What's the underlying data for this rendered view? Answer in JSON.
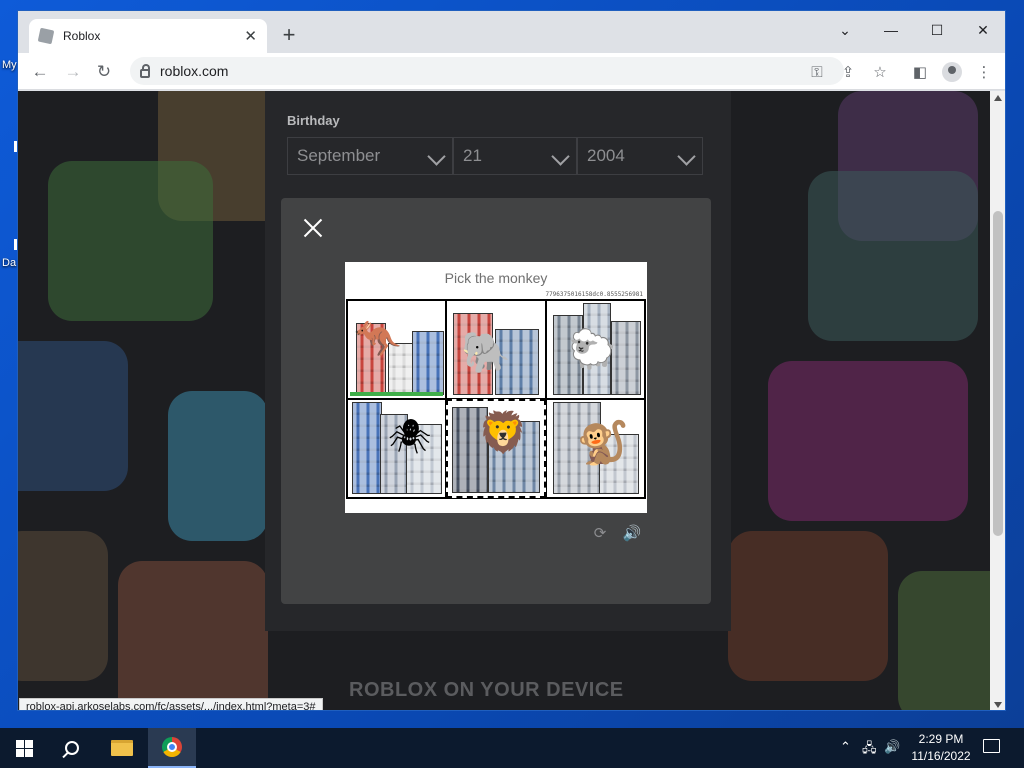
{
  "desktop": {
    "icon_label_1": "My",
    "icon_label_2": "Da"
  },
  "browser": {
    "tab_title": "Roblox",
    "url": "roblox.com",
    "status_url": "roblox-api.arkoselabs.com/fc/assets/.../index.html?meta=3#"
  },
  "signup": {
    "birthday_label": "Birthday",
    "month": "September",
    "day": "21",
    "year": "2004"
  },
  "captcha": {
    "title": "Pick the monkey",
    "challenge_id": "7796375016158dc0.8555256981",
    "tiles": [
      {
        "animal": "kangaroo",
        "glyph": "🦘"
      },
      {
        "animal": "elephant",
        "glyph": "🐘"
      },
      {
        "animal": "sheep",
        "glyph": "🐑"
      },
      {
        "animal": "spider",
        "glyph": "🕷"
      },
      {
        "animal": "lion",
        "glyph": "🦁",
        "selected": true
      },
      {
        "animal": "monkey",
        "glyph": "🐒"
      }
    ],
    "reload_glyph": "⟳",
    "audio_glyph": "🔊"
  },
  "page": {
    "device_heading": "ROBLOX ON YOUR DEVICE"
  },
  "taskbar": {
    "time": "2:29 PM",
    "date": "11/16/2022"
  },
  "colors": {
    "desktop_blue": "#0e5bd8",
    "page_bg": "#1d1e21",
    "modal_bg": "#424344",
    "taskbar_bg": "#0c1a2e"
  }
}
